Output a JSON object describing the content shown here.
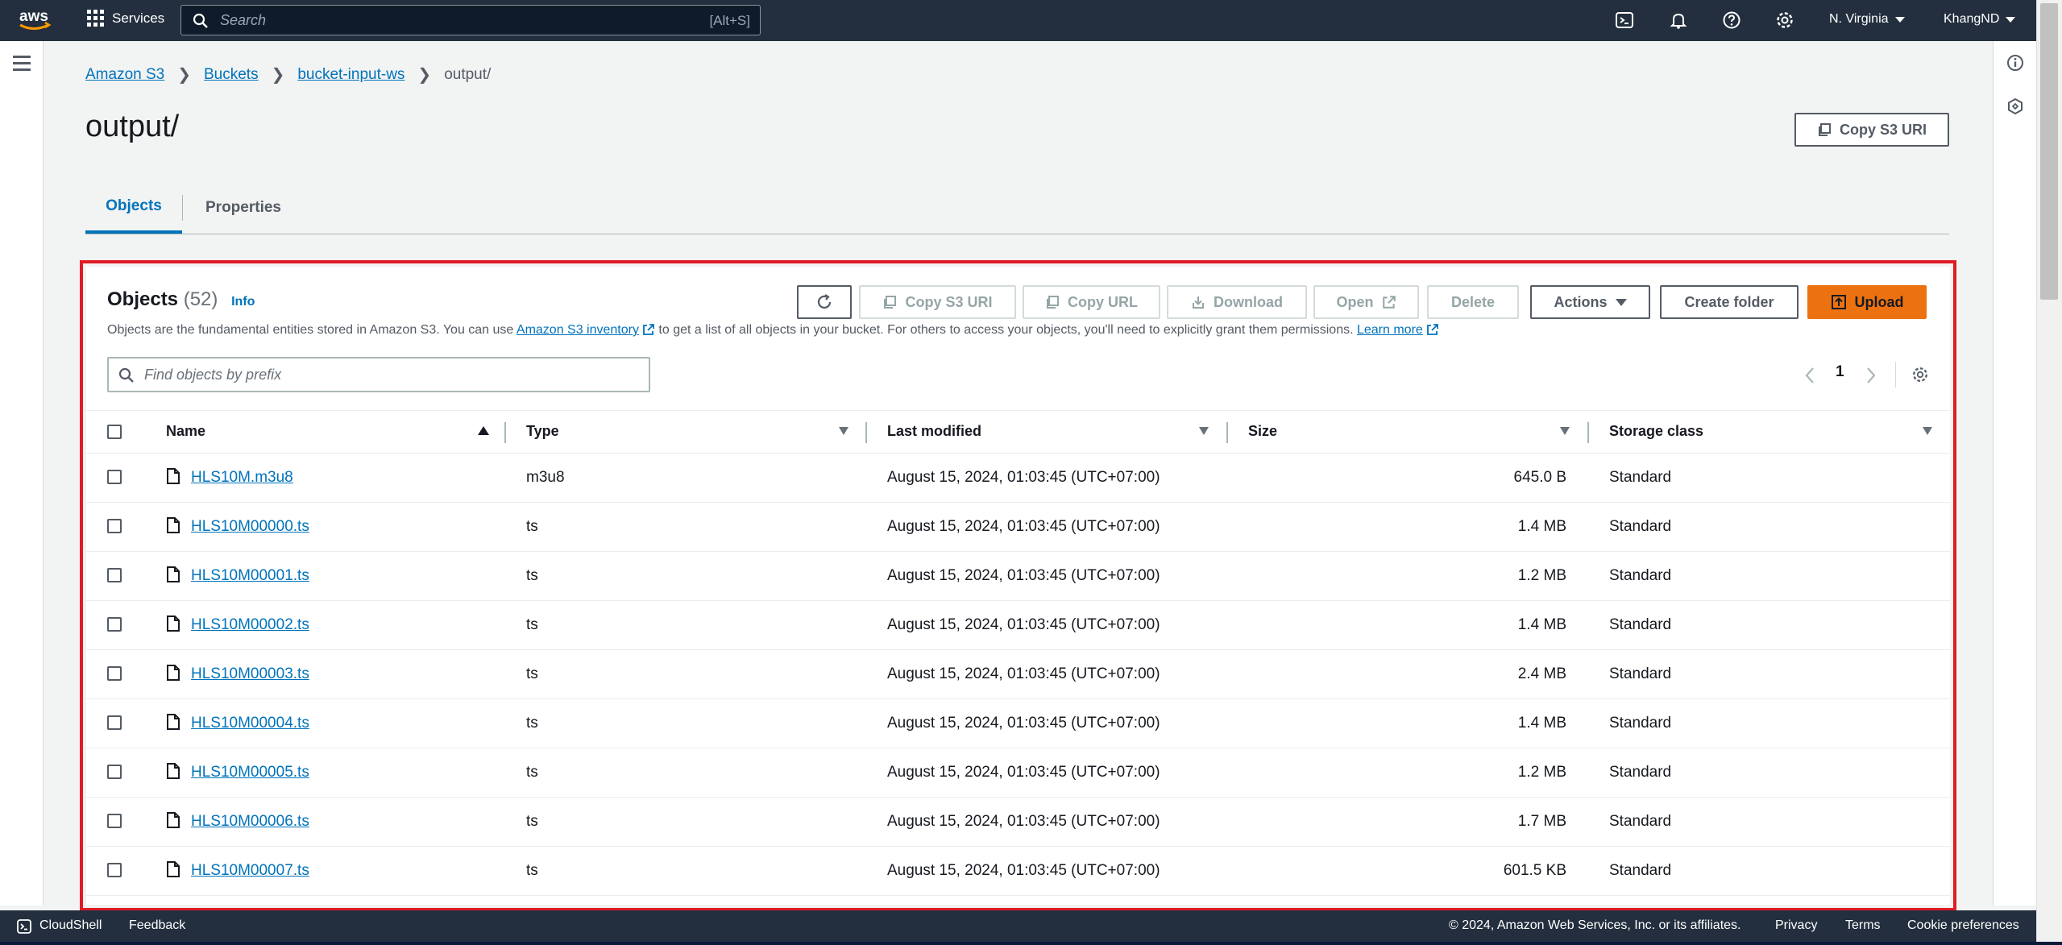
{
  "topnav": {
    "logo_text": "aws",
    "services_label": "Services",
    "search_placeholder": "Search",
    "search_shortcut": "[Alt+S]",
    "region": "N. Virginia",
    "account": "KhangND"
  },
  "breadcrumb": [
    "Amazon S3",
    "Buckets",
    "bucket-input-ws"
  ],
  "breadcrumb_current": "output/",
  "page_title": "output/",
  "header_copy_uri_label": "Copy S3 URI",
  "tabs": [
    {
      "label": "Objects",
      "active": true
    },
    {
      "label": "Properties",
      "active": false
    }
  ],
  "objects_panel": {
    "title": "Objects",
    "count": "(52)",
    "info_label": "Info",
    "desc_part1": "Objects are the fundamental entities stored in Amazon S3. You can use ",
    "desc_link1": "Amazon S3 inventory",
    "desc_part2": " to get a list of all objects in your bucket. For others to access your objects, you'll need to explicitly grant them permissions. ",
    "desc_link2": "Learn more",
    "toolbar": {
      "copy_s3_uri": "Copy S3 URI",
      "copy_url": "Copy URL",
      "download": "Download",
      "open": "Open",
      "delete": "Delete",
      "actions": "Actions",
      "create_folder": "Create folder",
      "upload": "Upload"
    },
    "find_placeholder": "Find objects by prefix",
    "page_number": "1"
  },
  "table": {
    "columns": [
      "Name",
      "Type",
      "Last modified",
      "Size",
      "Storage class"
    ],
    "rows": [
      {
        "name": "HLS10M.m3u8",
        "type": "m3u8",
        "modified": "August 15, 2024, 01:03:45 (UTC+07:00)",
        "size": "645.0 B",
        "storage": "Standard"
      },
      {
        "name": "HLS10M00000.ts",
        "type": "ts",
        "modified": "August 15, 2024, 01:03:45 (UTC+07:00)",
        "size": "1.4 MB",
        "storage": "Standard"
      },
      {
        "name": "HLS10M00001.ts",
        "type": "ts",
        "modified": "August 15, 2024, 01:03:45 (UTC+07:00)",
        "size": "1.2 MB",
        "storage": "Standard"
      },
      {
        "name": "HLS10M00002.ts",
        "type": "ts",
        "modified": "August 15, 2024, 01:03:45 (UTC+07:00)",
        "size": "1.4 MB",
        "storage": "Standard"
      },
      {
        "name": "HLS10M00003.ts",
        "type": "ts",
        "modified": "August 15, 2024, 01:03:45 (UTC+07:00)",
        "size": "2.4 MB",
        "storage": "Standard"
      },
      {
        "name": "HLS10M00004.ts",
        "type": "ts",
        "modified": "August 15, 2024, 01:03:45 (UTC+07:00)",
        "size": "1.4 MB",
        "storage": "Standard"
      },
      {
        "name": "HLS10M00005.ts",
        "type": "ts",
        "modified": "August 15, 2024, 01:03:45 (UTC+07:00)",
        "size": "1.2 MB",
        "storage": "Standard"
      },
      {
        "name": "HLS10M00006.ts",
        "type": "ts",
        "modified": "August 15, 2024, 01:03:45 (UTC+07:00)",
        "size": "1.7 MB",
        "storage": "Standard"
      },
      {
        "name": "HLS10M00007.ts",
        "type": "ts",
        "modified": "August 15, 2024, 01:03:45 (UTC+07:00)",
        "size": "601.5 KB",
        "storage": "Standard"
      }
    ]
  },
  "footer": {
    "cloudshell": "CloudShell",
    "feedback": "Feedback",
    "copyright": "© 2024, Amazon Web Services, Inc. or its affiliates.",
    "privacy": "Privacy",
    "terms": "Terms",
    "cookie": "Cookie preferences"
  },
  "colors": {
    "nav_bg": "#232f3e",
    "link": "#0073bb",
    "primary": "#ec7211",
    "highlight": "#e01b24"
  }
}
